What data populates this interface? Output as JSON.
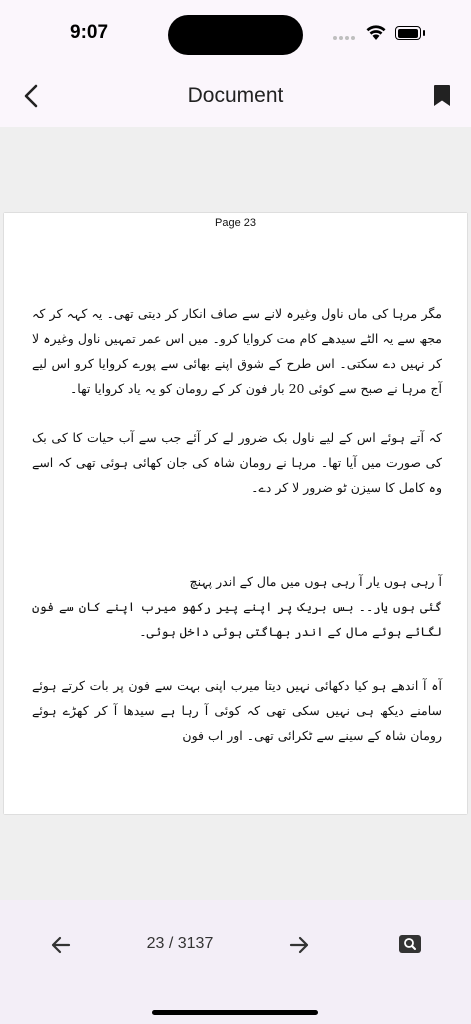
{
  "status_bar": {
    "time": "9:07"
  },
  "header": {
    "title": "Document",
    "back_icon": "chevron-left-icon",
    "bookmark_icon": "bookmark-icon"
  },
  "page": {
    "label": "Page 23",
    "paragraphs": [
      "مگر مرہا کی ماں ناول وغیرہ لانے سے صاف انکار کر دیتی تھی۔ یہ کہہ کر کہ مجھ سے یہ الٹے سیدھے کام مت کروایا کرو۔ میں اس عمر تمہیں ناول وغیرہ لا کر نہیں دے سکتی۔ اس طرح کے شوق اپنے بھائی سے پورے کروایا کرو اس لیے آج مرہا نے صبح سے کوئی 20 بار فون کر کے رومان کو یہ یاد کروایا تھا۔",
      "کہ آتے ہوئے اس کے لیے ناول بک ضرور لے کر آئے جب سے آب حیات کا کی بک کی صورت میں آیا تھا۔ مرہا نے رومان شاہ کی جان کھائی ہوئی تھی کہ اسے وہ کامل کا سیزن ٹو ضرور لا کر دے۔",
      "آ رہی ہوں یار آ رہی ہوں میں مال کے اندر پہنچ\nگئی ہوں یار۔۔ بس بریک پر اپنے پیر رکھو میرب اپنے کان سے فون لگائے ہوئے مال کے اندر بھاگتی ہوئی داخل ہوئی۔",
      "آہ آ اندھے ہو کیا دکھائی نہیں دیتا میرب اپنی بہت سے فون پر بات کرتے ہوئے سامنے دیکھ ہی نہیں سکی تھی کہ کوئی آ رہا ہے سیدھا آ کر کھڑے ہوئے رومان شاہ کے سینے سے ٹکرائی تھی۔ اور اب فون"
    ]
  },
  "bottom_bar": {
    "prev_icon": "arrow-left-icon",
    "page_count": "23 / 3137",
    "next_icon": "arrow-right-icon",
    "search_icon": "search-icon"
  }
}
